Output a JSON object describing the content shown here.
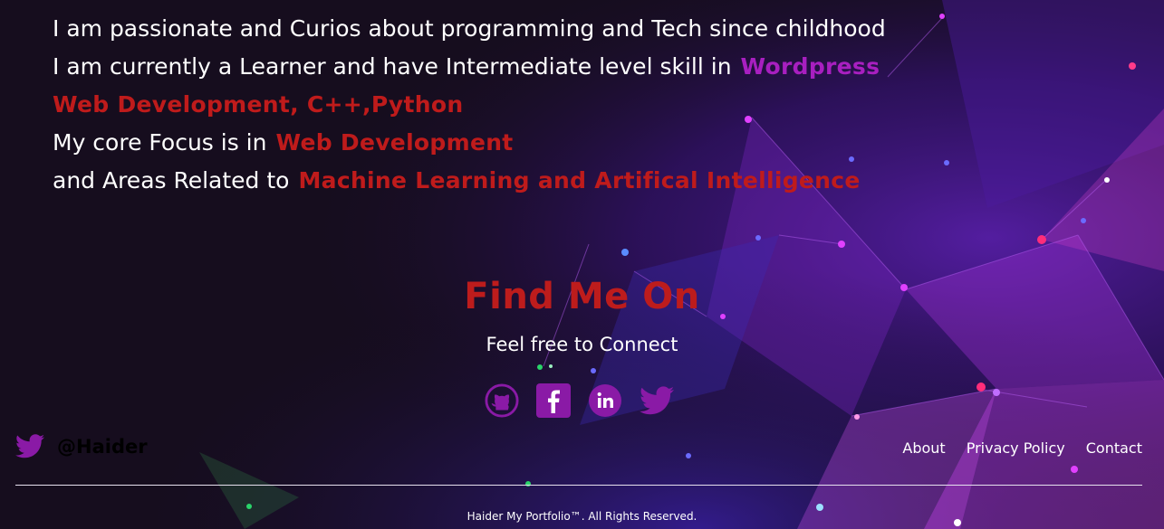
{
  "about": {
    "line1": "I am passionate and Curios about programming and Tech since childhood",
    "line2_text": "I am currently a Learner and have Intermediate level skill in",
    "line2_highlight": "Wordpress",
    "line3_highlight": "Web Development, C++,Python",
    "line4_text": "My core Focus is in",
    "line4_highlight": "Web Development",
    "line5_text": "and Areas Related to",
    "line5_highlight": "Machine Learning and Artifical Intelligence"
  },
  "find_me": {
    "title": "Find Me On",
    "subtitle": "Feel free to Connect"
  },
  "socials": [
    {
      "icon": "github-icon"
    },
    {
      "icon": "facebook-icon"
    },
    {
      "icon": "linkedin-icon"
    },
    {
      "icon": "twitter-icon"
    }
  ],
  "footer": {
    "handle": "@Haider",
    "handle_icon": "twitter-icon",
    "links": [
      "About",
      "Privacy Policy",
      "Contact"
    ],
    "copyright": "Haider My Portfolio™. All Rights Reserved."
  },
  "colors": {
    "highlight_red": "#bf1b1b",
    "highlight_purple": "#a81fc0",
    "icon_purple": "#8a1aa6",
    "background": "#160d1e"
  }
}
